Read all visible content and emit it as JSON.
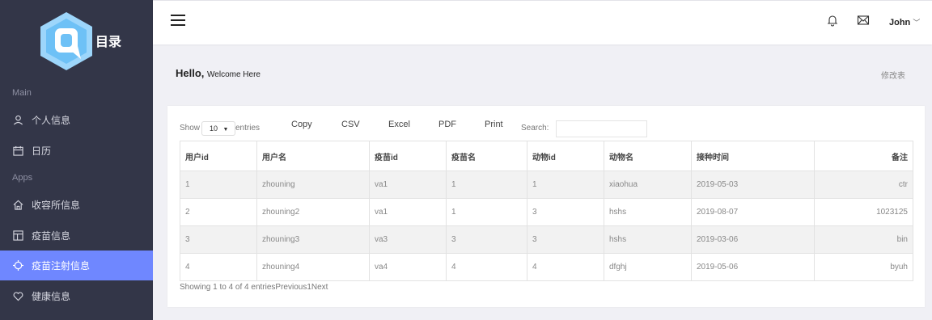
{
  "sidebar": {
    "logo_text": "目录",
    "sections": {
      "main": "Main",
      "apps": "Apps"
    },
    "items": [
      {
        "label": "个人信息",
        "icon": "user-icon"
      },
      {
        "label": "日历",
        "icon": "calendar-icon"
      },
      {
        "label": "收容所信息",
        "icon": "home-icon"
      },
      {
        "label": "疫苗信息",
        "icon": "layout-icon"
      },
      {
        "label": "疫苗注射信息",
        "icon": "crosshair-icon",
        "active": true
      },
      {
        "label": "健康信息",
        "icon": "heart-icon"
      }
    ]
  },
  "topbar": {
    "user": "John"
  },
  "page": {
    "hello": "Hello,",
    "welcome": "Welcome Here",
    "modify": "修改表"
  },
  "table_controls": {
    "show": "Show",
    "length_value": "10",
    "entries": "entries",
    "buttons": [
      "Copy",
      "CSV",
      "Excel",
      "PDF",
      "Print"
    ],
    "search_label": "Search:",
    "search_value": ""
  },
  "table": {
    "headers": [
      "用户id",
      "用户名",
      "疫苗id",
      "疫苗名",
      "动物id",
      "动物名",
      "接种时间",
      "备注"
    ],
    "rows": [
      [
        "1",
        "zhouning",
        "va1",
        "1",
        "1",
        "xiaohua",
        "2019-05-03",
        "ctr"
      ],
      [
        "2",
        "zhouning2",
        "va1",
        "1",
        "3",
        "hshs",
        "2019-08-07",
        "1023125"
      ],
      [
        "3",
        "zhouning3",
        "va3",
        "3",
        "3",
        "hshs",
        "2019-03-06",
        "bin"
      ],
      [
        "4",
        "zhouning4",
        "va4",
        "4",
        "4",
        "dfghj",
        "2019-05-06",
        "byuh"
      ]
    ]
  },
  "footer": {
    "info": "Showing 1 to 4 of 4 entriesPrevious1Next"
  },
  "colors": {
    "sidebar": "#333648",
    "active": "#6f87ff",
    "logo": "#8fd0fb"
  }
}
